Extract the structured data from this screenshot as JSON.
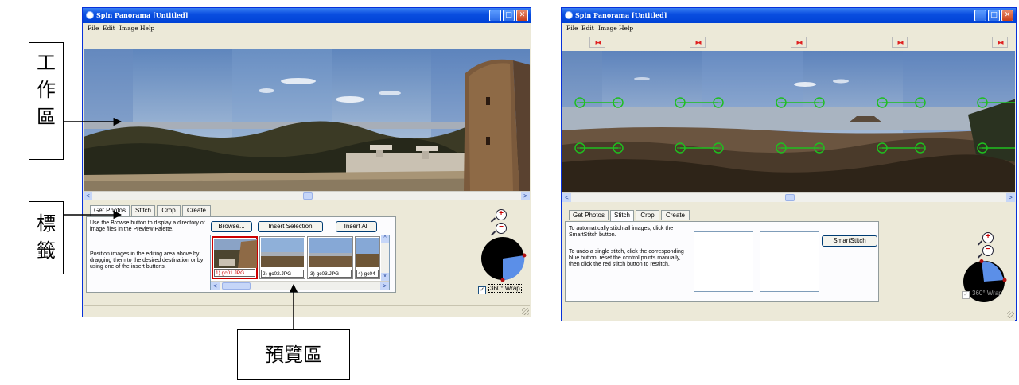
{
  "left_window": {
    "title": "Spin Panorama [Untitled]",
    "menu": [
      "File",
      "Edit",
      "Image",
      "Help"
    ],
    "tabs": [
      "Get Photos",
      "Stitch",
      "Crop",
      "Create"
    ],
    "active_tab": "Get Photos",
    "instructions_1": "Use the Browse button to display a directory of image files in the Preview Palette.",
    "instructions_2": "Position images in the editing area above by dragging them to the desired destination or by using one of the insert buttons.",
    "buttons": {
      "browse": "Browse...",
      "insert_selection": "Insert Selection",
      "insert_all": "Insert All"
    },
    "thumbnails": [
      "1) gc01.JPG",
      "2) gc02.JPG",
      "3) gc03.JPG",
      "4) gc04"
    ],
    "wrap_label": "360° Wrap",
    "wrap_checked": true
  },
  "right_window": {
    "title": "Spin Panorama [Untitled]",
    "menu": [
      "File",
      "Edit",
      "Image",
      "Help"
    ],
    "tabs": [
      "Get Photos",
      "Stitch",
      "Crop",
      "Create"
    ],
    "active_tab": "Stitch",
    "instructions_1": "To automatically stitch all images, click the SmartStitch button.",
    "instructions_2": "To undo a single stitch, click the corresponding blue button, reset the control points manually, then click the red stitch button to restitch.",
    "smartstitch_label": "SmartStitch",
    "wrap_label": "360° Wrap",
    "wrap_checked": true
  },
  "annotations": {
    "work_area": "工\n作\n區",
    "tabs": "標\n籤",
    "preview_area": "預覽區"
  },
  "colors": {
    "titlebar": "#0a4ee0",
    "window_bg": "#ece9d8",
    "control_point": "#1fbf1f",
    "stitch_marker": "#e02020",
    "selected_thumb": "#cc0000"
  },
  "icons": {
    "zoom_in": "zoom-in-magnifier-icon",
    "zoom_out": "zoom-out-magnifier-icon",
    "compass": "view-angle-dial-icon",
    "stitch": "stitch-arrows-icon"
  }
}
